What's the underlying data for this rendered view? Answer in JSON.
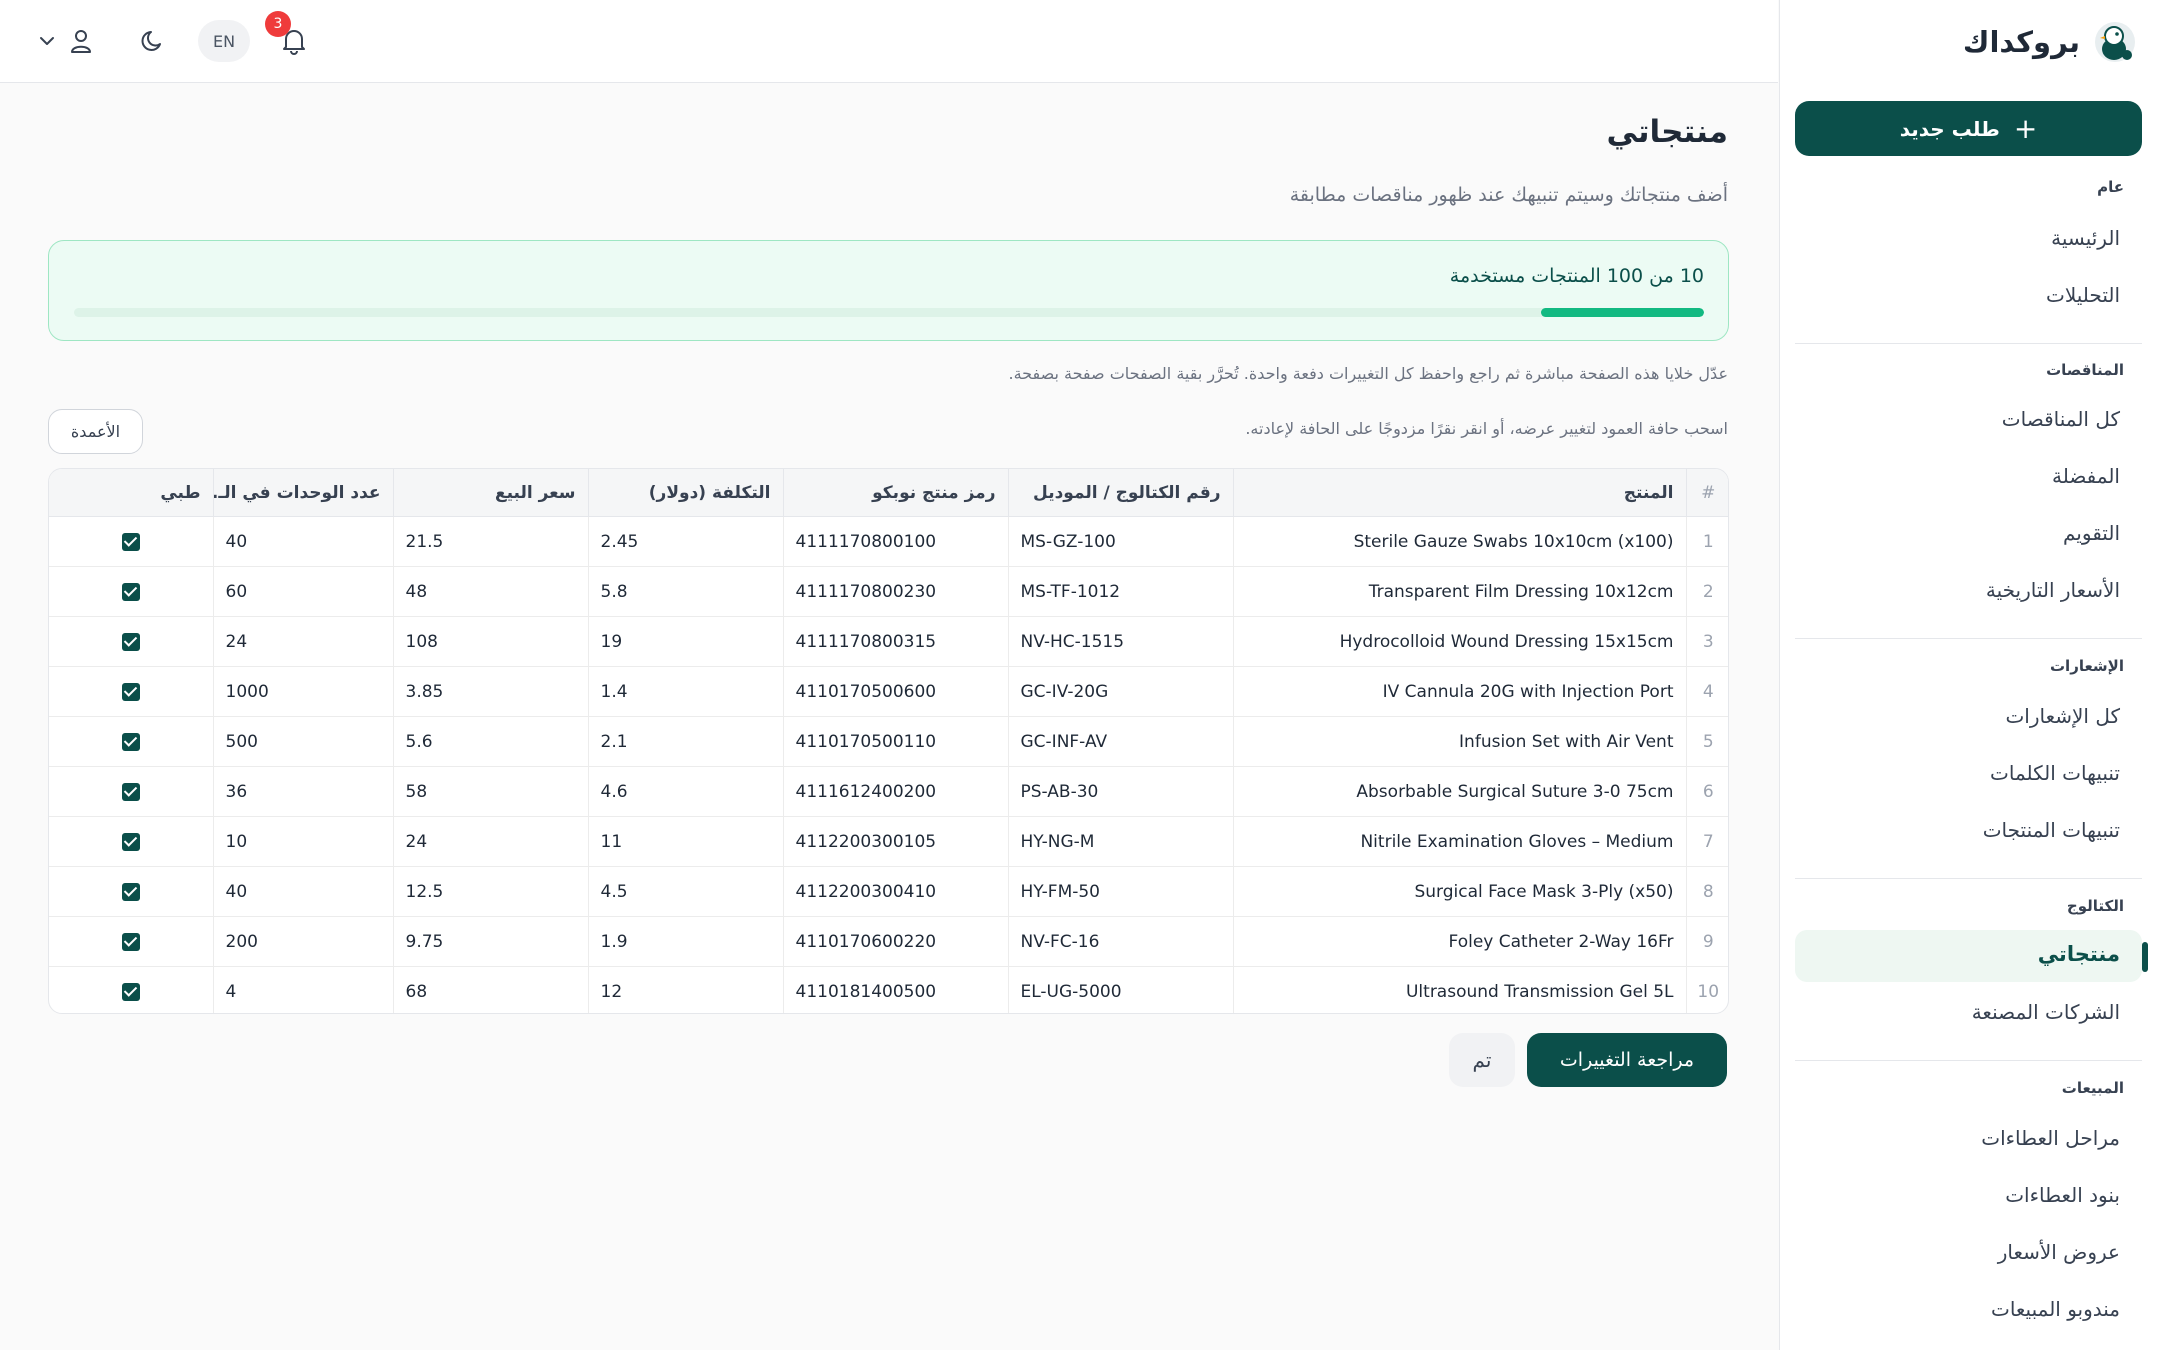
{
  "brand": {
    "name": "بروكداك"
  },
  "sidebar": {
    "new_order": "طلب جديد",
    "sections": [
      {
        "title": "عام",
        "items": [
          "الرئيسية",
          "التحليلات"
        ]
      },
      {
        "title": "المناقصات",
        "items": [
          "كل المناقصات",
          "المفضلة",
          "التقويم",
          "الأسعار التاريخية"
        ]
      },
      {
        "title": "الإشعارات",
        "items": [
          "كل الإشعارات",
          "تنبيهات الكلمات",
          "تنبيهات المنتجات"
        ]
      },
      {
        "title": "الكتالوج",
        "items": [
          "منتجاتي",
          "الشركات المصنعة"
        ]
      },
      {
        "title": "المبيعات",
        "items": [
          "مراحل العطاءات",
          "بنود العطاءات",
          "عروض الأسعار",
          "مندوبو المبيعات"
        ]
      }
    ],
    "active_item": "منتجاتي"
  },
  "topbar": {
    "language": "EN",
    "notification_count": "3",
    "icons": [
      "bell-icon",
      "moon-icon",
      "user-icon",
      "chevron-down-icon"
    ]
  },
  "page": {
    "title": "منتجاتي",
    "subtitle": "أضف منتجاتك وسيتم تنبيهك عند ظهور مناقصات مطابقة",
    "quota_text": "10 من 100 المنتجات مستخدمة",
    "quota_used": 10,
    "quota_total": 100,
    "hint_edit": "عدّل خلايا هذه الصفحة مباشرة ثم راجع واحفظ كل التغييرات دفعة واحدة. تُحرَّر بقية الصفحات صفحة بصفحة.",
    "hint_resize": "اسحب حافة العمود لتغيير عرضه، أو انقر نقرًا مزدوجًا على الحافة لإعادته.",
    "columns_button": "الأعمدة",
    "review_button": "مراجعة التغييرات",
    "done_button": "تم"
  },
  "table": {
    "headers": [
      "#",
      "المنتج",
      "رقم الكتالوج / الموديل",
      "رمز منتج نوبكو",
      "التكلفة (دولار)",
      "سعر البيع",
      "عدد الوحدات في الـ..",
      "طبي"
    ],
    "rows": [
      [
        "1",
        "Sterile Gauze Swabs 10x10cm (x100)",
        "MS-GZ-100",
        "4111170800100",
        "2.45",
        "21.5",
        "40"
      ],
      [
        "2",
        "Transparent Film Dressing 10x12cm",
        "MS-TF-1012",
        "4111170800230",
        "5.8",
        "48",
        "60"
      ],
      [
        "3",
        "Hydrocolloid Wound Dressing 15x15cm",
        "NV-HC-1515",
        "4111170800315",
        "19",
        "108",
        "24"
      ],
      [
        "4",
        "IV Cannula 20G with Injection Port",
        "GC-IV-20G",
        "4110170500600",
        "1.4",
        "3.85",
        "1000"
      ],
      [
        "5",
        "Infusion Set with Air Vent",
        "GC-INF-AV",
        "4110170500110",
        "2.1",
        "5.6",
        "500"
      ],
      [
        "6",
        "Absorbable Surgical Suture 3-0 75cm",
        "PS-AB-30",
        "4111612400200",
        "4.6",
        "58",
        "36"
      ],
      [
        "7",
        "Nitrile Examination Gloves – Medium",
        "HY-NG-M",
        "4112200300105",
        "11",
        "24",
        "10"
      ],
      [
        "8",
        "Surgical Face Mask 3-Ply (x50)",
        "HY-FM-50",
        "4112200300410",
        "4.5",
        "12.5",
        "40"
      ],
      [
        "9",
        "Foley Catheter 2-Way 16Fr",
        "NV-FC-16",
        "4110170600220",
        "1.9",
        "9.75",
        "200"
      ],
      [
        "10",
        "Ultrasound Transmission Gel 5L",
        "EL-UG-5000",
        "4110181400500",
        "12",
        "68",
        "4"
      ]
    ],
    "medical_checked": [
      true,
      true,
      true,
      true,
      true,
      true,
      true,
      true,
      true,
      true
    ]
  },
  "colors": {
    "primary": "#0b4f4a",
    "accent_green": "#12b981",
    "badge_red": "#ef3b3b"
  }
}
